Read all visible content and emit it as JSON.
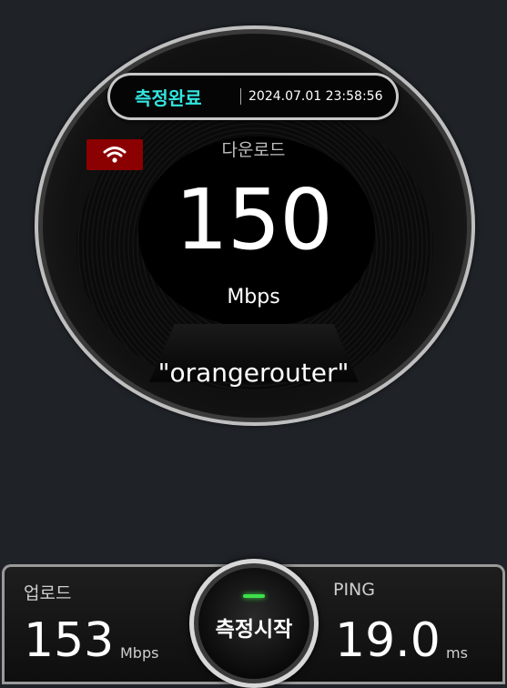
{
  "status": {
    "label": "측정완료",
    "timestamp": "2024.07.01 23:58:56"
  },
  "download": {
    "label": "다운로드",
    "value": "150",
    "unit": "Mbps"
  },
  "network": {
    "ssid": "\"orangerouter\"",
    "icon": "wifi-icon"
  },
  "upload": {
    "label": "업로드",
    "value": "153",
    "unit": "Mbps"
  },
  "ping": {
    "label": "PING",
    "value": "19.0",
    "unit": "ms"
  },
  "start_button": {
    "label": "측정시작"
  },
  "colors": {
    "background": "#1f2328",
    "status_accent": "#32e6e0",
    "wifi_badge": "#8b0000",
    "indicator": "#3ee04a"
  }
}
